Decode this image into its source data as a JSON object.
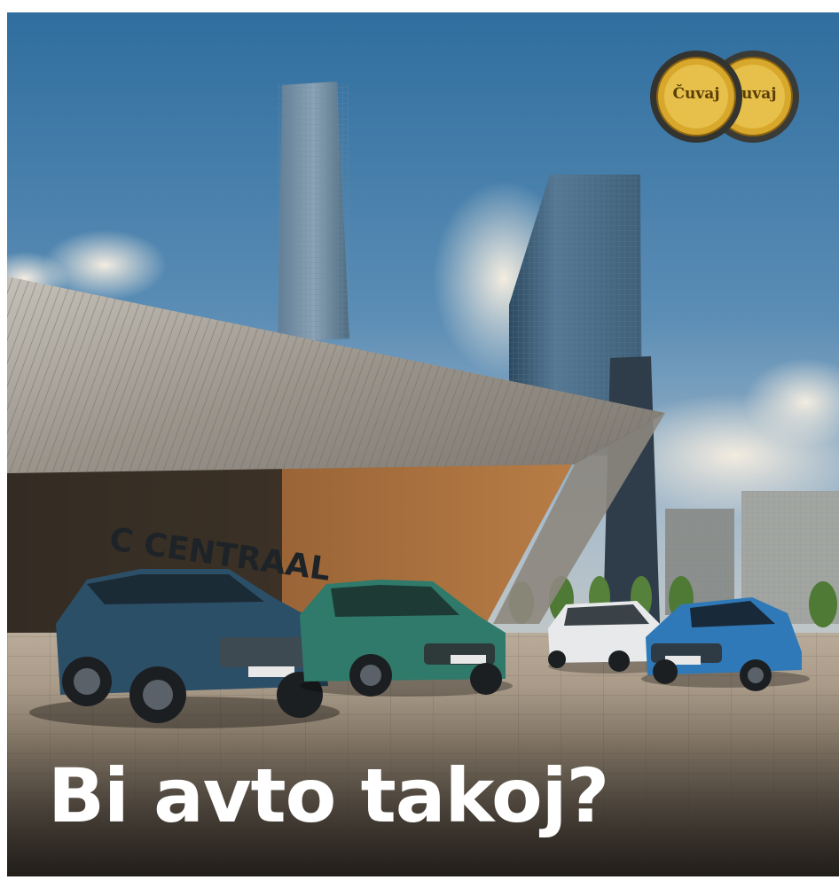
{
  "ad": {
    "headline": "Bi avto takoj?",
    "awards": {
      "count": 2,
      "medal_text": "Čuvaj"
    }
  },
  "colors": {
    "sky": "#3a78ab",
    "headline": "#ffffff",
    "medal_gold": "#d8a82c",
    "car_blue": "#2c4f68",
    "car_green": "#2f7a6a",
    "car_white": "#e7e9ea",
    "car_light_blue": "#2f79b8"
  }
}
